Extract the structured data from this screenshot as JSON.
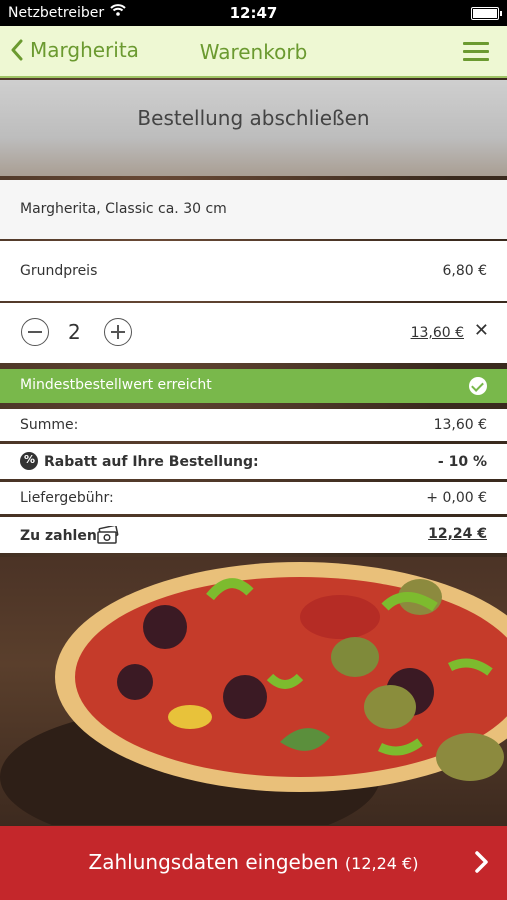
{
  "status_bar": {
    "carrier": "Netzbetreiber",
    "time": "12:47"
  },
  "nav": {
    "back_label": "Margherita",
    "title": "Warenkorb"
  },
  "header": {
    "title": "Bestellung abschließen"
  },
  "cart_item": {
    "name": "Margherita, Classic ca. 30 cm",
    "base_price_label": "Grundpreis",
    "base_price": "6,80 €",
    "quantity": "2",
    "line_total": "13,60 €"
  },
  "notice": {
    "text": "Mindestbestellwert erreicht"
  },
  "summary": {
    "sum_label": "Summe:",
    "sum_value": "13,60 €",
    "discount_label": "Rabatt auf Ihre Bestellung:",
    "discount_value": "- 10 %",
    "fee_label": "Liefergebühr:",
    "fee_value": "+ 0,00 €",
    "pay_label": "Zu zahlen",
    "pay_value": "12,24 €"
  },
  "cta": {
    "label": "Zahlungsdaten eingeben",
    "amount": "(12,24 €)"
  },
  "colors": {
    "accent_green": "#79b84b",
    "nav_green": "#6b9a30",
    "cta_red": "#c4272b"
  }
}
